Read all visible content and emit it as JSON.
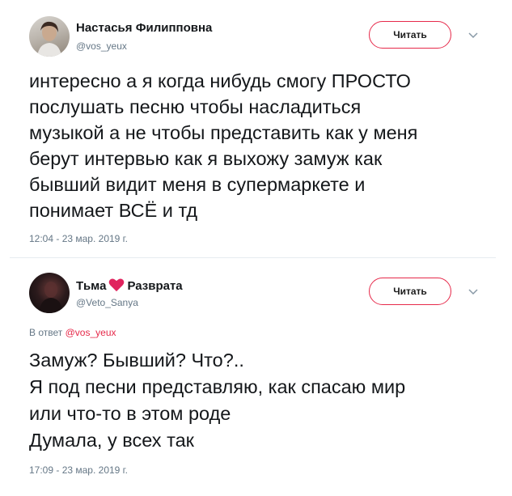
{
  "tweets": [
    {
      "author_name": "Настасья Филипповна",
      "handle": "@vos_yeux",
      "follow_label": "Читать",
      "text": "интересно а я когда нибудь смогу ПРОСТО\nпослушать песню чтобы насладиться\nмузыкой а не чтобы представить как у меня\nберут интервью как я выхожу замуж как\nбывший видит меня в супермаркете и\nпонимает ВСЁ и тд",
      "timestamp": "12:04 - 23 мар. 2019 г."
    },
    {
      "author_name_part1": "Тьма",
      "author_name_part2": "Разврата",
      "handle": "@Veto_Sanya",
      "follow_label": "Читать",
      "reply_prefix": "В ответ",
      "reply_handle": "@vos_yeux",
      "text": "Замуж? Бывший? Что?..\nЯ под песни представляю, как спасаю мир\nили что-то в этом роде\nДумала, у всех так",
      "timestamp": "17:09 - 23 мар. 2019 г."
    }
  ],
  "icons": {
    "chevron": "chevron-down-icon",
    "heart": "heart-icon"
  },
  "colors": {
    "accent": "#e6294a",
    "secondary_text": "#657786",
    "primary_text": "#14171a",
    "divider": "#e6ecf0"
  }
}
